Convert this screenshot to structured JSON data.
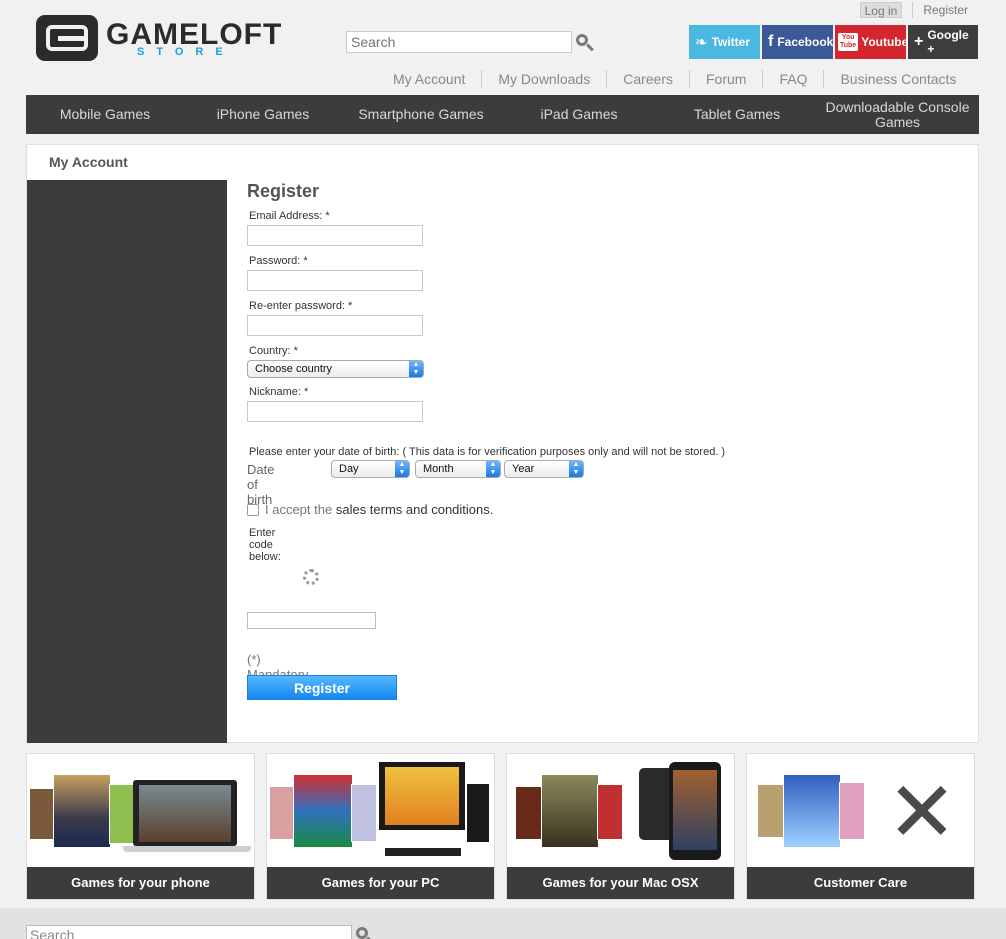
{
  "header": {
    "logo_name": "GAMELOFT",
    "logo_sub": "STORE",
    "login": "Log in",
    "register": "Register",
    "search_placeholder": "Search",
    "social": {
      "twitter": "Twitter",
      "facebook": "Facebook",
      "youtube": "Youtube",
      "youtube_logo_top": "You",
      "youtube_logo_bottom": "Tube",
      "google": "Google +"
    },
    "sub_nav": [
      "My Account",
      "My Downloads",
      "Careers",
      "Forum",
      "FAQ",
      "Business Contacts"
    ],
    "main_nav": [
      "Mobile Games",
      "iPhone Games",
      "Smartphone Games",
      "iPad Games",
      "Tablet Games",
      "Downloadable Console Games"
    ]
  },
  "panel": {
    "title": "My Account",
    "form": {
      "title": "Register",
      "email_label": "Email Address: *",
      "password_label": "Password: *",
      "reenter_label": "Re-enter password: *",
      "country_label": "Country: *",
      "country_value": "Choose country",
      "nickname_label": "Nickname: *",
      "dob_note": "Please enter your date of birth: ( This data is for verification purposes only and will not be stored. )",
      "dob_label": "Date of birth *",
      "day": "Day",
      "month": "Month",
      "year": "Year",
      "accept_prefix": "I accept the",
      "accept_link": "sales terms and conditions.",
      "code_label": "Enter code below:",
      "mandatory": "(*) Mandatory",
      "register_button": "Register"
    }
  },
  "promos": [
    {
      "label": "Games for your phone"
    },
    {
      "label": "Games for your PC"
    },
    {
      "label": "Games for your Mac OSX"
    },
    {
      "label": "Customer Care"
    }
  ],
  "footer": {
    "search_placeholder": "Search"
  },
  "colors": {
    "nav_bg": "#3c3c3c",
    "accent_blue": "#1a9fe0",
    "twitter": "#4ab8e0",
    "facebook": "#3b5998",
    "youtube": "#d3262e",
    "google": "#3d3d3d"
  }
}
